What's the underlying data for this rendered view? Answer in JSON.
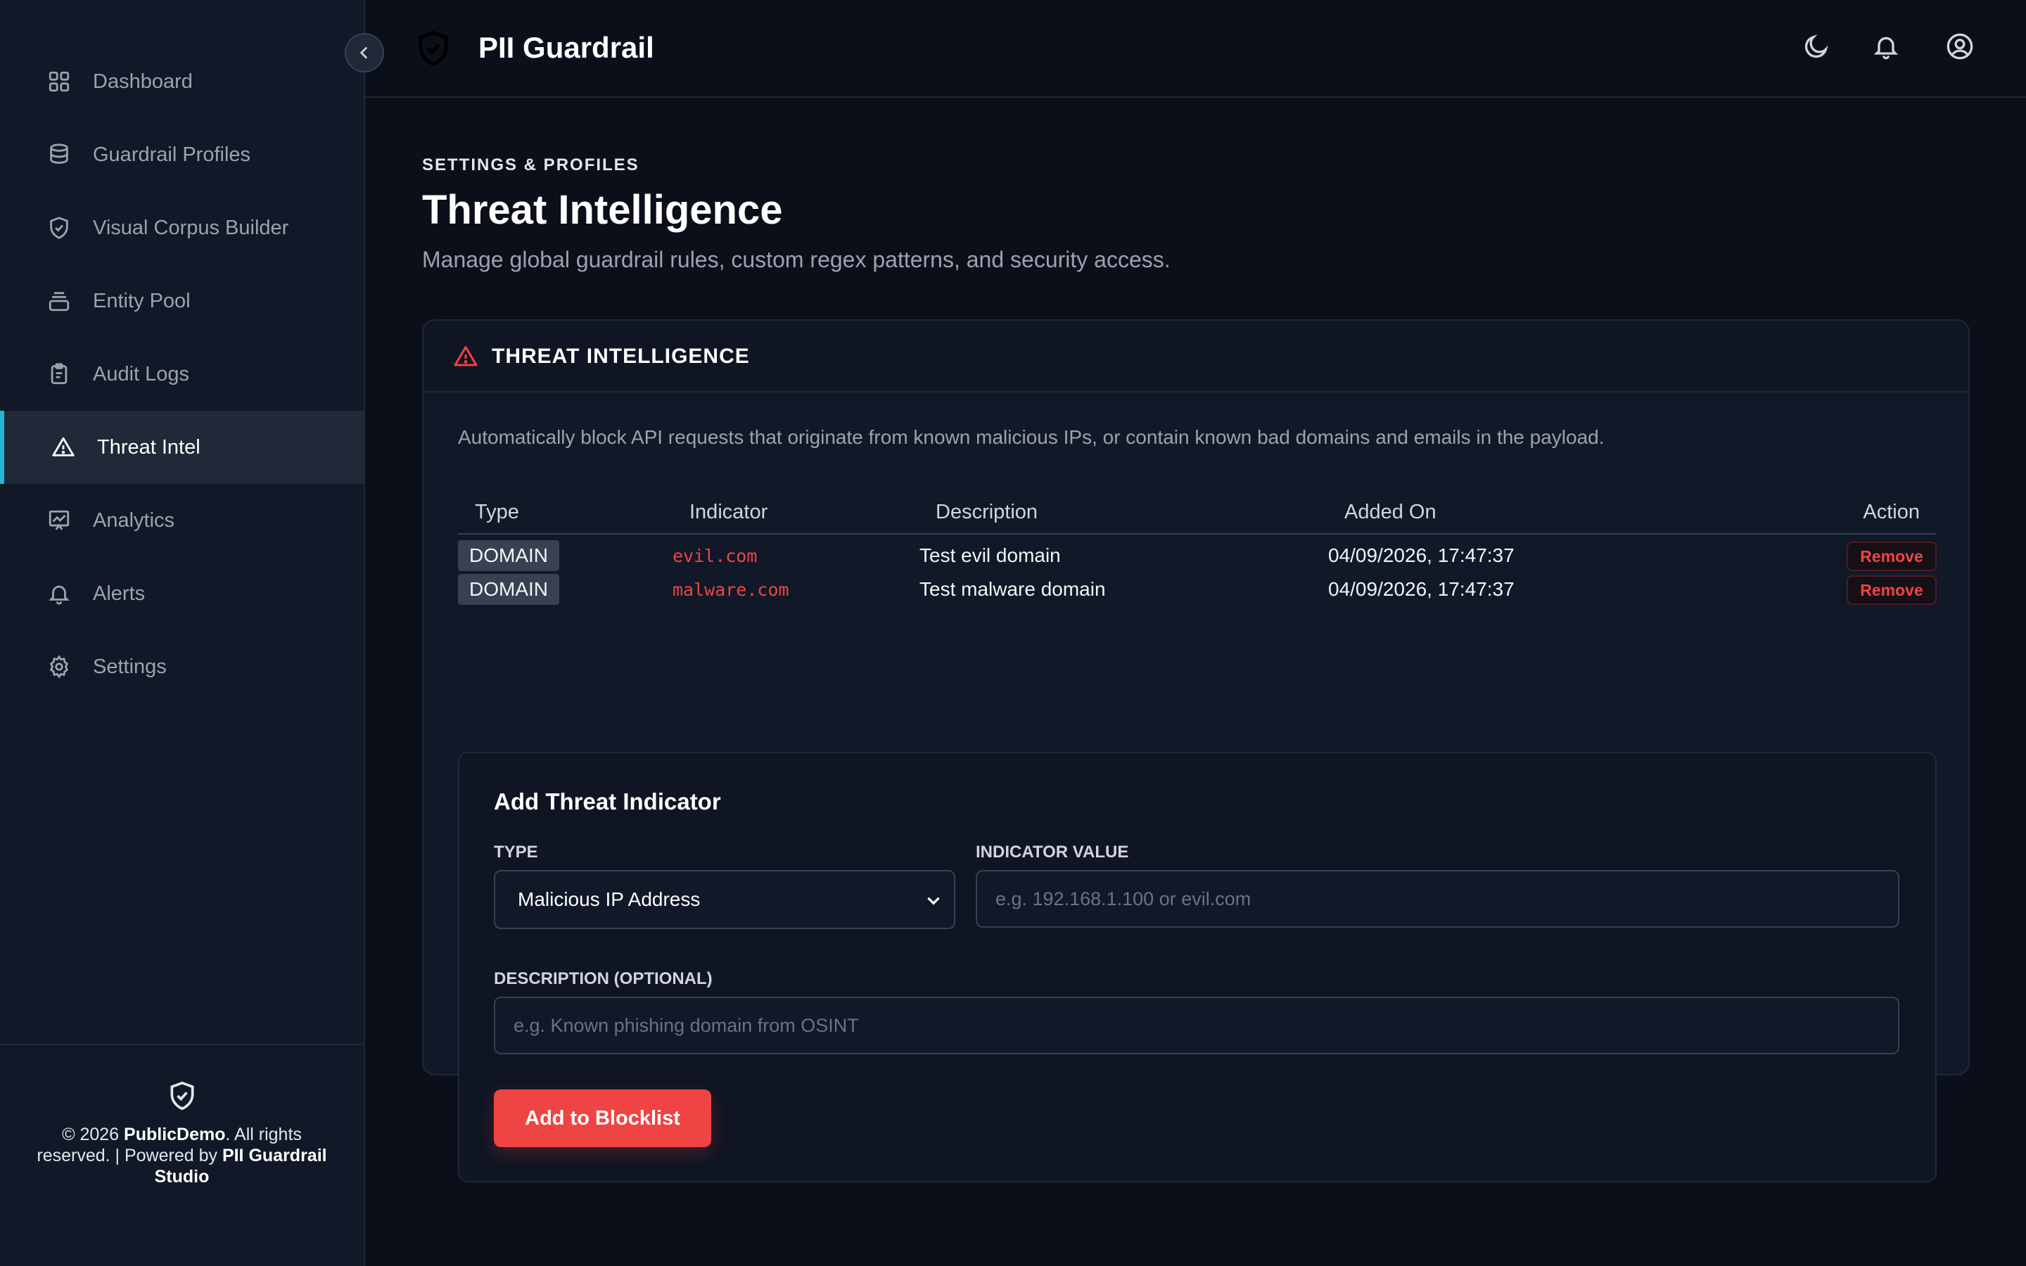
{
  "app": {
    "title": "PII Guardrail"
  },
  "sidebar": {
    "items": [
      {
        "label": "Dashboard",
        "icon": "grid-icon"
      },
      {
        "label": "Guardrail Profiles",
        "icon": "database-icon"
      },
      {
        "label": "Visual Corpus Builder",
        "icon": "shield-check-icon"
      },
      {
        "label": "Entity Pool",
        "icon": "layers-icon"
      },
      {
        "label": "Audit Logs",
        "icon": "clipboard-icon"
      },
      {
        "label": "Threat Intel",
        "icon": "warning-triangle-icon",
        "active": true
      },
      {
        "label": "Analytics",
        "icon": "chart-icon"
      },
      {
        "label": "Alerts",
        "icon": "bell-icon"
      },
      {
        "label": "Settings",
        "icon": "gear-icon"
      }
    ],
    "footer": {
      "copyright_prefix": "© 2026 ",
      "company": "PublicDemo",
      "rights": ". All rights reserved. | Powered by ",
      "product": "PII Guardrail Studio"
    }
  },
  "header": {
    "kicker": "SETTINGS & PROFILES",
    "title": "Threat Intelligence",
    "subtitle": "Manage global guardrail rules, custom regex patterns, and security access."
  },
  "card": {
    "title": "THREAT INTELLIGENCE",
    "description": "Automatically block API requests that originate from known malicious IPs, or contain known bad domains and emails in the payload.",
    "columns": [
      "Type",
      "Indicator",
      "Description",
      "Added On",
      "Action"
    ],
    "rows": [
      {
        "type": "DOMAIN",
        "indicator": "evil.com",
        "description": "Test evil domain",
        "added_on": "04/09/2026, 17:47:37",
        "action": "Remove"
      },
      {
        "type": "DOMAIN",
        "indicator": "malware.com",
        "description": "Test malware domain",
        "added_on": "04/09/2026, 17:47:37",
        "action": "Remove"
      }
    ]
  },
  "form": {
    "title": "Add Threat Indicator",
    "type_label": "TYPE",
    "type_value": "Malicious IP Address",
    "indicator_label": "INDICATOR VALUE",
    "indicator_placeholder": "e.g. 192.168.1.100 or evil.com",
    "description_label": "DESCRIPTION (OPTIONAL)",
    "description_placeholder": "e.g. Known phishing domain from OSINT",
    "submit_label": "Add to Blocklist"
  },
  "colors": {
    "accent": "#22b8cf",
    "danger": "#ef4444",
    "bg": "#0b0f19",
    "panel": "#111827"
  }
}
